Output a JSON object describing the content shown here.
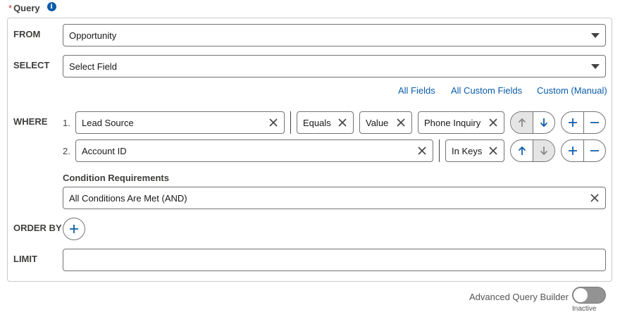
{
  "header": {
    "required_mark": "*",
    "title": "Query",
    "info_icon": "info-icon"
  },
  "colors": {
    "accent": "#0b5cab",
    "border": "#747474",
    "panel_border": "#c9c9c9",
    "required": "#c23934"
  },
  "from": {
    "label": "FROM",
    "value": "Opportunity"
  },
  "select": {
    "label": "SELECT",
    "value": "Select Field"
  },
  "field_links": [
    "All Fields",
    "All Custom Fields",
    "Custom (Manual)"
  ],
  "where": {
    "label": "WHERE",
    "conditions": [
      {
        "index": "1.",
        "field": "Lead Source",
        "operator": "Equals",
        "value_type": "Value",
        "value": "Phone Inquiry"
      },
      {
        "index": "2.",
        "field": "Account ID",
        "operator": "In Keys"
      }
    ]
  },
  "condition_requirements": {
    "label": "Condition Requirements",
    "value": "All Conditions Are Met (AND)"
  },
  "order_by": {
    "label": "ORDER BY"
  },
  "limit": {
    "label": "LIMIT",
    "value": ""
  },
  "advanced": {
    "label": "Advanced Query Builder",
    "status": "Inactive"
  }
}
